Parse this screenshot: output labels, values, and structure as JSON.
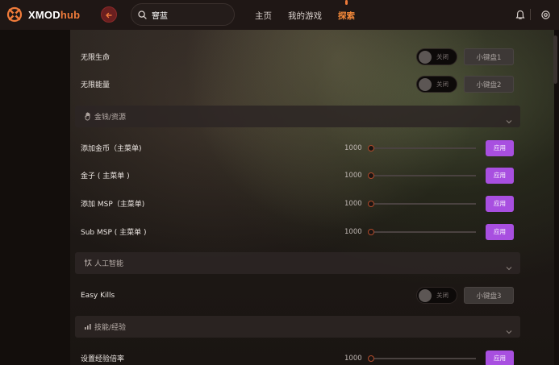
{
  "app": {
    "logo_main": "XMOD",
    "logo_accent": "hub"
  },
  "search": {
    "value": "窨蓝",
    "placeholder": ""
  },
  "nav": {
    "home": "主页",
    "my_games": "我的游戏",
    "explore": "探索"
  },
  "colors": {
    "accent": "#f07b3a",
    "apply": "#a84fe0",
    "back_button": "#6a1f1f"
  },
  "toggle_rows": [
    {
      "label": "无限生命",
      "toggle_text": "关闭",
      "toggle_on": false,
      "key": "小键盘1"
    },
    {
      "label": "无限能量",
      "toggle_text": "关闭",
      "toggle_on": false,
      "key": "小键盘2"
    }
  ],
  "sections": {
    "money": {
      "label": "金钱/资源",
      "icon": "hand-icon"
    },
    "ai": {
      "label": "人工智能",
      "icon": "ai-icon"
    },
    "skills": {
      "label": "技能/经验",
      "icon": "bar-chart-icon"
    }
  },
  "slider_rows": [
    {
      "label": "添加金币（主菜单)",
      "value": "1000",
      "apply": "应用"
    },
    {
      "label": "金子 ( 主菜单 )",
      "value": "1000",
      "apply": "应用"
    },
    {
      "label": "添加 MSP（主菜单)",
      "value": "1000",
      "apply": "应用"
    },
    {
      "label": "Sub MSP ( 主菜单 )",
      "value": "1000",
      "apply": "应用"
    }
  ],
  "ai_rows": [
    {
      "label": "Easy Kills",
      "toggle_text": "关闭",
      "toggle_on": false,
      "key": "小键盘3"
    }
  ],
  "skill_rows": [
    {
      "label": "设置经验倍率",
      "value": "1000",
      "apply": "应用"
    }
  ]
}
